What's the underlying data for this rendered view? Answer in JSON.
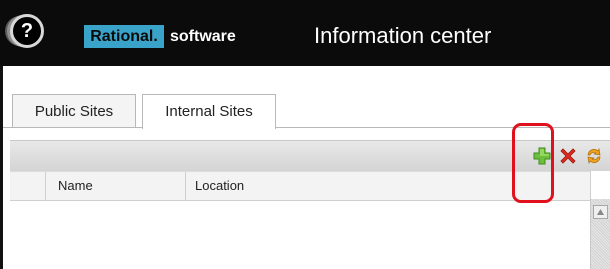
{
  "header": {
    "logo_glyph": "?",
    "brand_name": "Rational.",
    "brand_suffix": "software",
    "title": "Information center",
    "background_color": "#0b0b0b",
    "brand_box_color": "#3aa3c9"
  },
  "tabs": [
    {
      "label": "Public Sites",
      "selected": false
    },
    {
      "label": "Internal Sites",
      "selected": true
    }
  ],
  "toolbar": {
    "icons": [
      "add-icon",
      "delete-icon",
      "refresh-icon"
    ],
    "highlight_color": "#e0111d"
  },
  "table": {
    "columns": [
      "Name",
      "Location"
    ],
    "rows": []
  }
}
